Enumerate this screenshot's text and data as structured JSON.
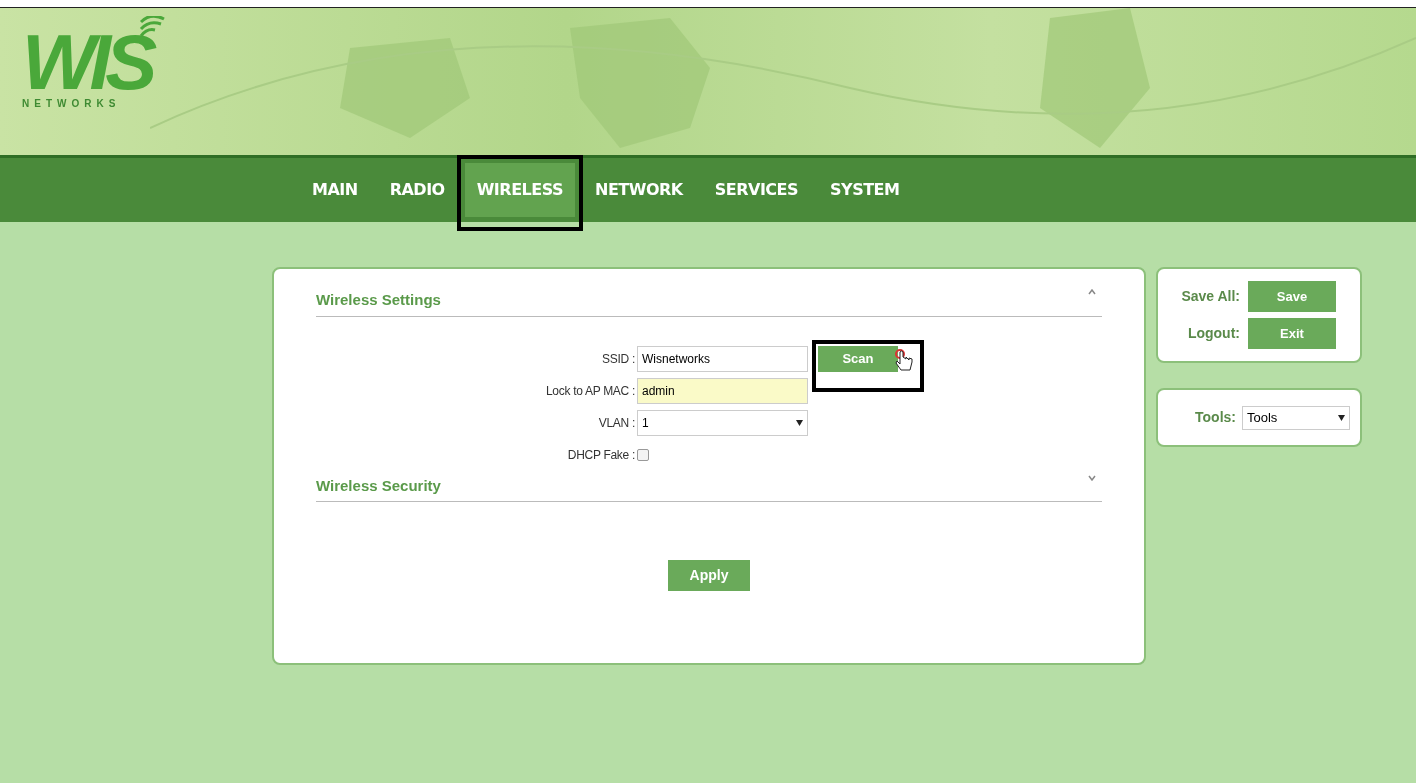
{
  "logo": {
    "text": "WIS",
    "subtitle": "NETWORKS"
  },
  "nav": [
    {
      "label": "MAIN",
      "selected": false,
      "highlighted": false
    },
    {
      "label": "RADIO",
      "selected": false,
      "highlighted": false
    },
    {
      "label": "WIRELESS",
      "selected": true,
      "highlighted": true
    },
    {
      "label": "NETWORK",
      "selected": false,
      "highlighted": false
    },
    {
      "label": "SERVICES",
      "selected": false,
      "highlighted": false
    },
    {
      "label": "SYSTEM",
      "selected": false,
      "highlighted": false
    }
  ],
  "sections": [
    {
      "title": "Wireless Settings",
      "expanded": true,
      "fields": [
        {
          "kind": "text",
          "label": "SSID :",
          "value": "Wisnetworks",
          "button": "Scan",
          "highlighted": true
        },
        {
          "kind": "autofill",
          "label": "Lock to AP MAC :",
          "value": "admin"
        },
        {
          "kind": "select",
          "label": "VLAN :",
          "value": "1"
        },
        {
          "kind": "checkbox",
          "label": "DHCP Fake :",
          "checked": false
        }
      ]
    },
    {
      "title": "Wireless Security",
      "expanded": false
    }
  ],
  "apply_button": "Apply",
  "side_actions": [
    {
      "label": "Save All:",
      "button": "Save"
    },
    {
      "label": "Logout:",
      "button": "Exit"
    }
  ],
  "tools": {
    "label": "Tools:",
    "value": "Tools"
  }
}
